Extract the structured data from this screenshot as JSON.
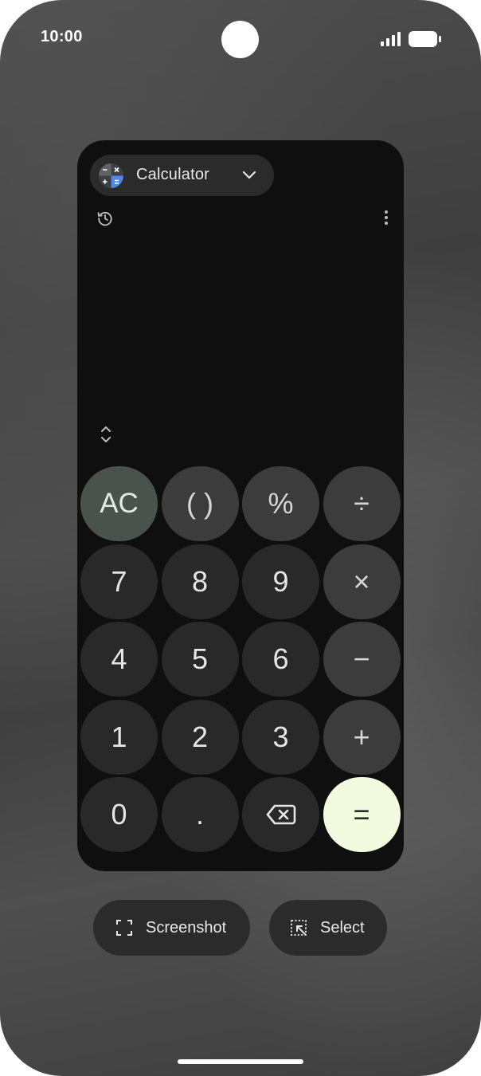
{
  "status_bar": {
    "time": "10:00",
    "icons": [
      "front-camera",
      "signal-icon",
      "battery-icon"
    ]
  },
  "app": {
    "title": "Calculator",
    "icons": {
      "logo": "calculator-app-icon",
      "dropdown": "chevron-down-icon",
      "history": "history-icon",
      "menu": "more-vert-icon",
      "expand": "unfold-icon"
    },
    "keys": [
      {
        "id": "ac",
        "label": "AC",
        "style": "ac"
      },
      {
        "id": "parentheses",
        "label": "( )",
        "style": "op"
      },
      {
        "id": "percent",
        "label": "%",
        "style": "op"
      },
      {
        "id": "divide",
        "label": "÷",
        "style": "op"
      },
      {
        "id": "7",
        "label": "7",
        "style": "num"
      },
      {
        "id": "8",
        "label": "8",
        "style": "num"
      },
      {
        "id": "9",
        "label": "9",
        "style": "num"
      },
      {
        "id": "multiply",
        "label": "×",
        "style": "op"
      },
      {
        "id": "4",
        "label": "4",
        "style": "num"
      },
      {
        "id": "5",
        "label": "5",
        "style": "num"
      },
      {
        "id": "6",
        "label": "6",
        "style": "num"
      },
      {
        "id": "minus",
        "label": "−",
        "style": "op"
      },
      {
        "id": "1",
        "label": "1",
        "style": "num"
      },
      {
        "id": "2",
        "label": "2",
        "style": "num"
      },
      {
        "id": "3",
        "label": "3",
        "style": "num"
      },
      {
        "id": "plus",
        "label": "+",
        "style": "op"
      },
      {
        "id": "0",
        "label": "0",
        "style": "num"
      },
      {
        "id": "decimal",
        "label": ".",
        "style": "num"
      },
      {
        "id": "backspace",
        "label": "",
        "icon": "backspace-icon",
        "style": "num"
      },
      {
        "id": "equals",
        "label": "=",
        "style": "eq"
      }
    ]
  },
  "actions": {
    "screenshot_label": "Screenshot",
    "select_label": "Select",
    "screenshot_icon": "screenshot-frame-icon",
    "select_icon": "select-region-icon"
  },
  "colors": {
    "key_number": "#282928",
    "key_operator": "#3b3c3b",
    "key_clear": "#4a524d",
    "key_equals": "#f2fbdf",
    "window_bg": "#0f0f0f"
  }
}
